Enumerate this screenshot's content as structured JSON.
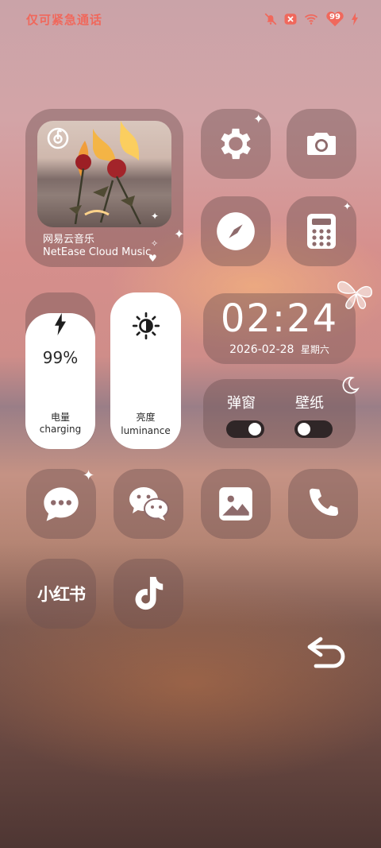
{
  "status_bar": {
    "carrier_text": "仅可紧急通话",
    "battery_level": "99"
  },
  "music_widget": {
    "app_name": "网易云音乐",
    "app_name_en": "NetEase Cloud Music"
  },
  "clock_widget": {
    "time": "02:24",
    "date": "2026-02-28",
    "weekday": "星期六"
  },
  "battery_widget": {
    "percent": "99%",
    "label_cn": "电量",
    "label_en": "charging"
  },
  "brightness_widget": {
    "label_cn": "亮度",
    "label_en": "luminance"
  },
  "toggles": [
    {
      "label": "弹窗",
      "state": "on"
    },
    {
      "label": "壁纸",
      "state": "off"
    }
  ],
  "apps": {
    "xiaohongshu_label": "小红书"
  },
  "icons": [
    "muted-bell-icon",
    "no-sim-icon",
    "wifi-icon",
    "battery-icon",
    "charging-bolt-icon",
    "settings-gear-icon",
    "camera-icon",
    "compass-icon",
    "calculator-icon",
    "lightning-icon",
    "sun-icon",
    "message-icon",
    "wechat-icon",
    "gallery-icon",
    "phone-icon",
    "tiktok-icon",
    "back-arrow-icon",
    "netease-logo-icon",
    "butterfly-icon",
    "moon-icon"
  ]
}
